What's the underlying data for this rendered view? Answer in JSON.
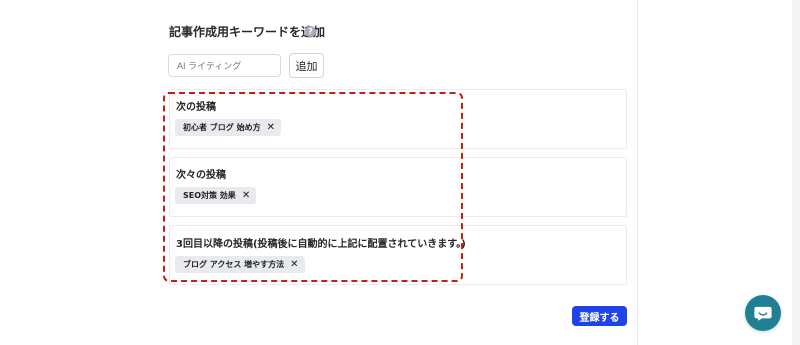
{
  "keyword_panel": {
    "title": "記事作成用キーワードを追加",
    "help_icon": "?",
    "input_placeholder": "AI ライティング",
    "add_button": "追加",
    "submit_button": "登録する"
  },
  "posts": {
    "next": {
      "title": "次の投稿",
      "chip_text": "初心者 ブログ 始め方",
      "close_symbol": "✕"
    },
    "after_next": {
      "title": "次々の投稿",
      "chip_text": "SEO対策 効果",
      "close_symbol": "✕"
    },
    "third_onward": {
      "title": "3回目以降の投稿(投稿後に自動的に上記に配置されていきます。)",
      "chip_text": "ブログ アクセス 増やす方法",
      "close_symbol": "✕"
    }
  },
  "colors": {
    "accent": "#1E44E8",
    "highlight": "#C51F0F",
    "chat": "#1F7F94"
  }
}
